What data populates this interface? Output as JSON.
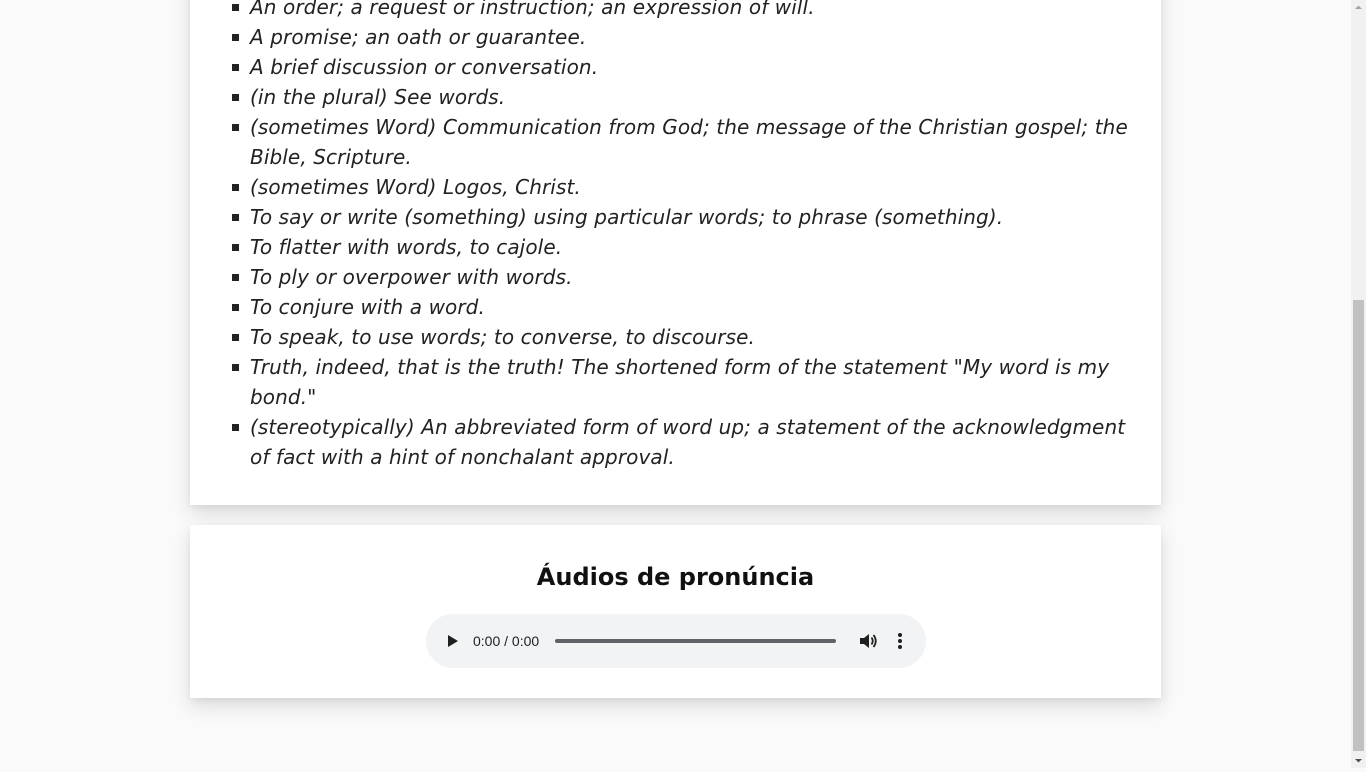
{
  "definitions": {
    "items": [
      "An order; a request or instruction; an expression of will.",
      "A promise; an oath or guarantee.",
      "A brief discussion or conversation.",
      "(in the plural) See words.",
      "(sometimes Word) Communication from God; the message of the Christian gospel; the Bible, Scripture.",
      "(sometimes Word) Logos, Christ.",
      "To say or write (something) using particular words; to phrase (something).",
      "To flatter with words, to cajole.",
      "To ply or overpower with words.",
      "To conjure with a word.",
      "To speak, to use words; to converse, to discourse.",
      "Truth, indeed, that is the truth! The shortened form of the statement \"My word is my bond.\"",
      "(stereotypically) An abbreviated form of word up; a statement of the acknowledgment of fact with a hint of nonchalant approval."
    ]
  },
  "audio": {
    "title": "Áudios de pronúncia",
    "time": "0:00 / 0:00",
    "progress": 0,
    "icons": {
      "play": "play-icon",
      "volume": "volume-icon",
      "more": "more-vertical-icon"
    }
  },
  "scrollbar": {
    "position": "bottom"
  },
  "colors": {
    "page_background": "#fafafa",
    "card_background": "#ffffff",
    "player_background": "#f1f3f4"
  }
}
